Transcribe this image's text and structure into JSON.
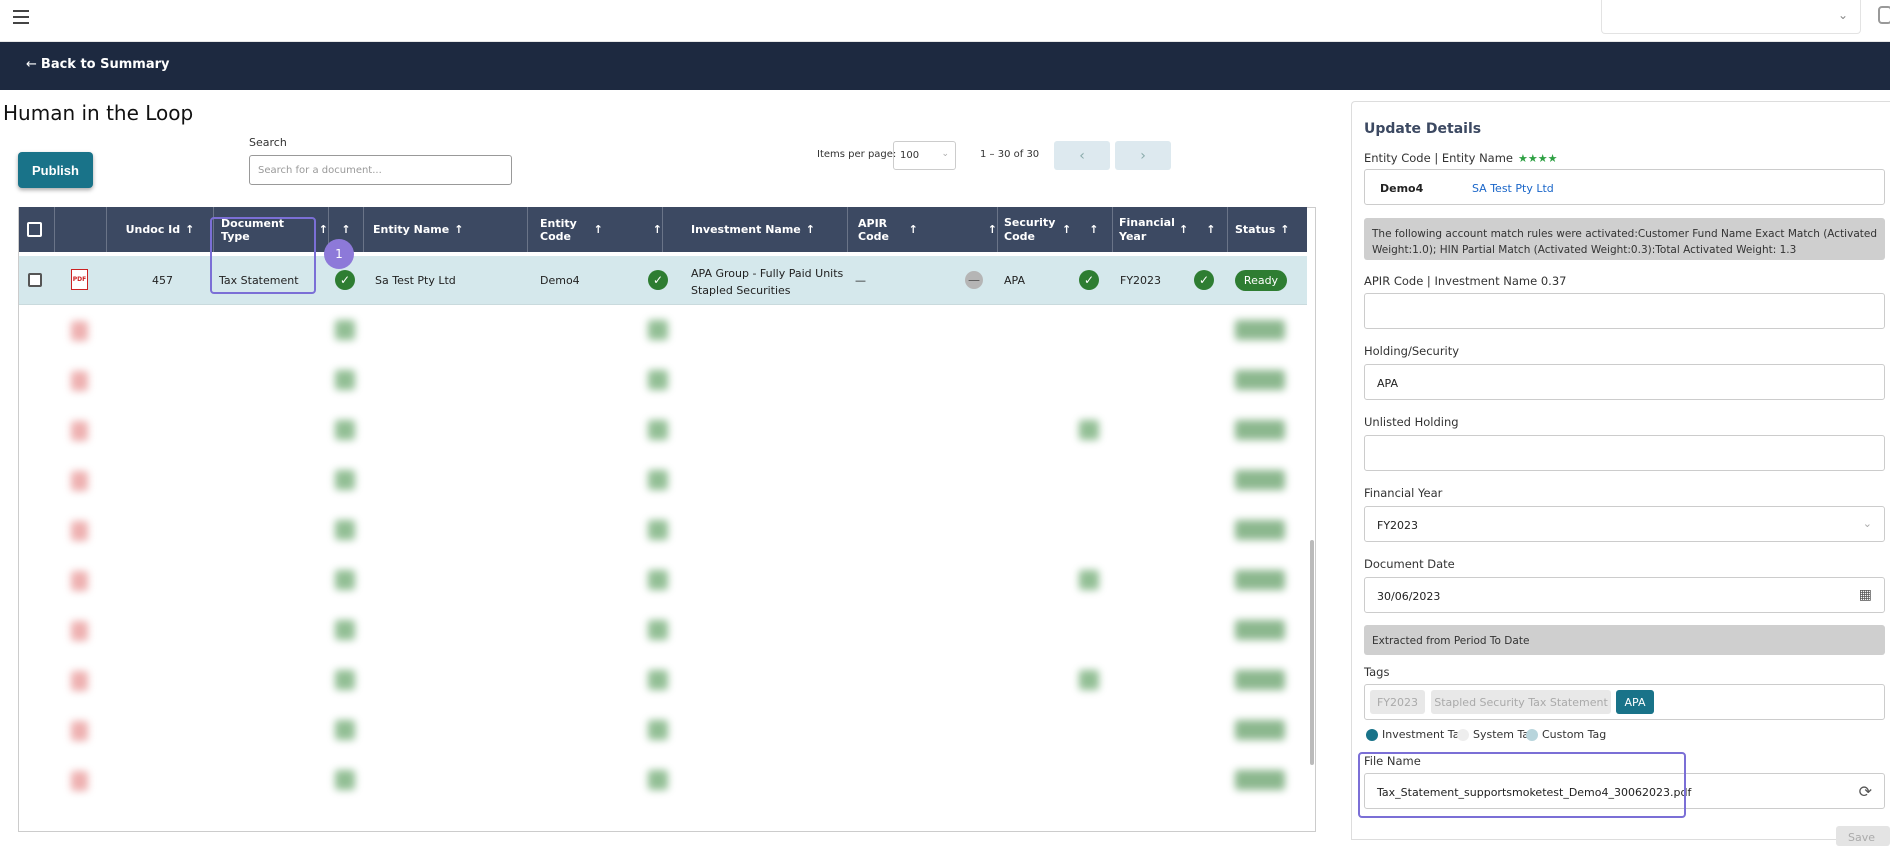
{
  "topbar": {
    "menu_icon": "hamburger-menu-icon",
    "select_chevron": "⌄"
  },
  "navbar": {
    "back_arrow": "←",
    "back_label": "Back to Summary"
  },
  "page": {
    "title": "Human in the Loop"
  },
  "toolbar": {
    "publish_label": "Publish",
    "search_label": "Search",
    "search_placeholder": "Search for a document...",
    "items_per_page_label": "Items per page:",
    "items_per_page_value": "100",
    "range_text": "1 – 30 of 30",
    "prev_icon": "‹",
    "next_icon": "›"
  },
  "table": {
    "headers": {
      "undoc_id": "Undoc Id",
      "document_type": "Document Type",
      "entity_name": "Entity Name",
      "entity_code": "Entity Code",
      "investment_name": "Investment Name",
      "apir_code": "APIR Code",
      "security_code": "Security Code",
      "financial_year": "Financial Year",
      "status": "Status"
    },
    "sort_arrow": "↑",
    "row": {
      "undoc_id": "457",
      "document_type": "Tax Statement",
      "entity_name": "Sa Test Pty Ltd",
      "entity_code": "Demo4",
      "investment_name_line1": "APA Group - Fully Paid Units",
      "investment_name_line2": "Stapled Securities",
      "apir_code": "—",
      "security_code": "APA",
      "financial_year": "FY2023",
      "status": "Ready",
      "pdf_icon_text": "PDF",
      "check": "✓",
      "minus": "—"
    },
    "step_badge": "1"
  },
  "panel": {
    "title": "Update Details",
    "entity_label": "Entity Code | Entity Name",
    "entity_stars": "★★★★",
    "entity_code": "Demo4",
    "entity_name": "SA Test Pty Ltd",
    "match_rules": "The following account match rules were activated:Customer Fund Name Exact Match (Activated Weight:1.0); HIN Partial Match (Activated Weight:0.3):Total Activated Weight: 1.3",
    "apir_label": "APIR Code | Investment Name 0.37",
    "holding_label": "Holding/Security",
    "holding_value": "APA",
    "unlisted_label": "Unlisted Holding",
    "fy_label": "Financial Year",
    "fy_value": "FY2023",
    "doc_date_label": "Document Date",
    "doc_date_value": "30/06/2023",
    "extracted_note": "Extracted from Period To Date",
    "tags_label": "Tags",
    "tags": [
      "FY2023",
      "Stapled Security Tax Statement",
      "APA"
    ],
    "legend": [
      "Investment Tag",
      "System Tag",
      "Custom Tag"
    ],
    "file_name_label": "File Name",
    "file_name_value": "Tax_Statement_supportsmoketest_Demo4_30062023.pdf",
    "refresh_icon": "⟳",
    "calendar_icon": "▦",
    "save_label": "Save"
  },
  "colors": {
    "navbar": "#1d2940",
    "accent": "#197389",
    "header": "#3c4962",
    "success": "#2e7d32",
    "highlight": "#7b6fd6"
  }
}
